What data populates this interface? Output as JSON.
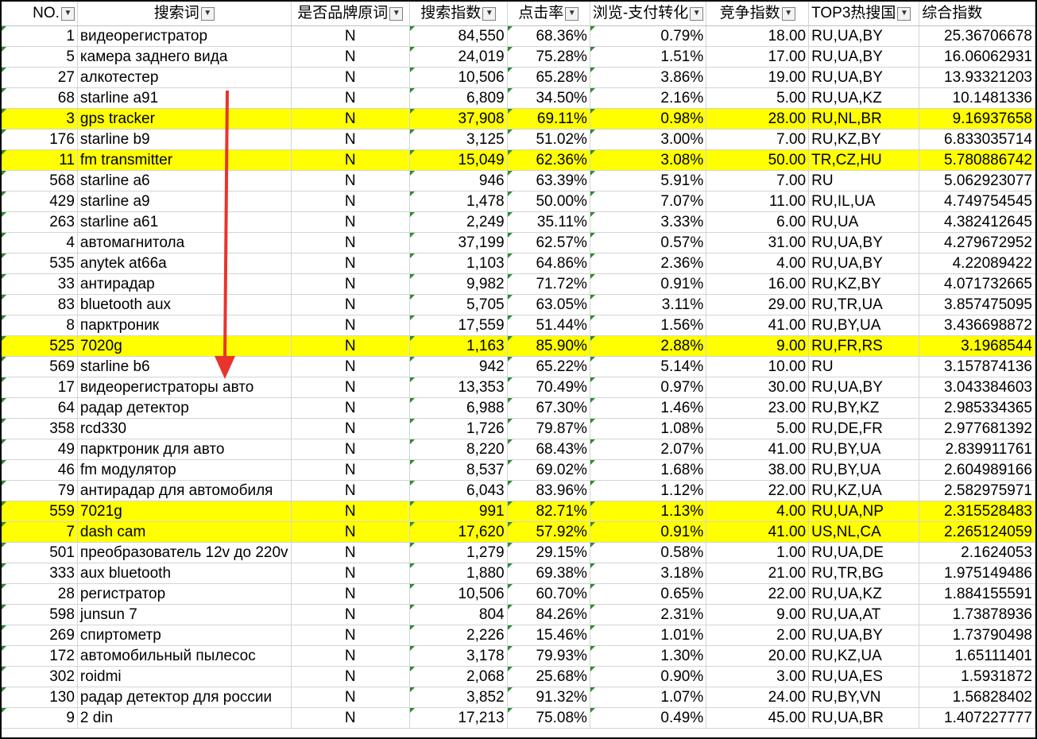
{
  "colors": {
    "highlight": "#ffff00",
    "arrow": "#e8342c",
    "corner_marker": "#2e8b2e"
  },
  "headers": [
    {
      "label": "NO.",
      "filter_icon": "dropdown-arrow-icon"
    },
    {
      "label": "搜索词",
      "filter_icon": "dropdown-arrow-icon"
    },
    {
      "label": "是否品牌原词",
      "filter_icon": "dropdown-arrow-icon"
    },
    {
      "label": "搜索指数",
      "filter_icon": "dropdown-arrow-icon"
    },
    {
      "label": "点击率",
      "filter_icon": "dropdown-arrow-icon"
    },
    {
      "label": "浏览-支付转化",
      "filter_icon": "dropdown-arrow-icon"
    },
    {
      "label": "竞争指数",
      "filter_icon": "dropdown-arrow-icon"
    },
    {
      "label": "TOP3热搜国",
      "filter_icon": "dropdown-arrow-icon"
    },
    {
      "label": "综合指数",
      "filter_icon": ""
    }
  ],
  "rows": [
    {
      "no": "1",
      "term": "видеорегистратор",
      "brand": "N",
      "search": "84,550",
      "ctr": "68.36%",
      "conv": "0.79%",
      "comp": "18.00",
      "top3": "RU,UA,BY",
      "score": "25.36706678",
      "highlight": false
    },
    {
      "no": "5",
      "term": "камера заднего вида",
      "brand": "N",
      "search": "24,019",
      "ctr": "75.28%",
      "conv": "1.51%",
      "comp": "17.00",
      "top3": "RU,UA,BY",
      "score": "16.06062931",
      "highlight": false
    },
    {
      "no": "27",
      "term": "алкотестер",
      "brand": "N",
      "search": "10,506",
      "ctr": "65.28%",
      "conv": "3.86%",
      "comp": "19.00",
      "top3": "RU,UA,BY",
      "score": "13.93321203",
      "highlight": false
    },
    {
      "no": "68",
      "term": "starline a91",
      "brand": "N",
      "search": "6,809",
      "ctr": "34.50%",
      "conv": "2.16%",
      "comp": "5.00",
      "top3": "RU,UA,KZ",
      "score": "10.1481336",
      "highlight": false
    },
    {
      "no": "3",
      "term": "gps tracker",
      "brand": "N",
      "search": "37,908",
      "ctr": "69.11%",
      "conv": "0.98%",
      "comp": "28.00",
      "top3": "RU,NL,BR",
      "score": "9.16937658",
      "highlight": true
    },
    {
      "no": "176",
      "term": "starline b9",
      "brand": "N",
      "search": "3,125",
      "ctr": "51.02%",
      "conv": "3.00%",
      "comp": "7.00",
      "top3": "RU,KZ,BY",
      "score": "6.833035714",
      "highlight": false
    },
    {
      "no": "11",
      "term": "fm transmitter",
      "brand": "N",
      "search": "15,049",
      "ctr": "62.36%",
      "conv": "3.08%",
      "comp": "50.00",
      "top3": "TR,CZ,HU",
      "score": "5.780886742",
      "highlight": true
    },
    {
      "no": "568",
      "term": "starline a6",
      "brand": "N",
      "search": "946",
      "ctr": "63.39%",
      "conv": "5.91%",
      "comp": "7.00",
      "top3": "RU",
      "score": "5.062923077",
      "highlight": false
    },
    {
      "no": "429",
      "term": "starline a9",
      "brand": "N",
      "search": "1,478",
      "ctr": "50.00%",
      "conv": "7.07%",
      "comp": "11.00",
      "top3": "RU,IL,UA",
      "score": "4.749754545",
      "highlight": false
    },
    {
      "no": "263",
      "term": "starline a61",
      "brand": "N",
      "search": "2,249",
      "ctr": "35.11%",
      "conv": "3.33%",
      "comp": "6.00",
      "top3": "RU,UA",
      "score": "4.382412645",
      "highlight": false
    },
    {
      "no": "4",
      "term": "автомагнитола",
      "brand": "N",
      "search": "37,199",
      "ctr": "62.57%",
      "conv": "0.57%",
      "comp": "31.00",
      "top3": "RU,UA,BY",
      "score": "4.279672952",
      "highlight": false
    },
    {
      "no": "535",
      "term": "anytek at66a",
      "brand": "N",
      "search": "1,103",
      "ctr": "64.86%",
      "conv": "2.36%",
      "comp": "4.00",
      "top3": "RU,UA,BY",
      "score": "4.22089422",
      "highlight": false
    },
    {
      "no": "33",
      "term": "антирадар",
      "brand": "N",
      "search": "9,982",
      "ctr": "71.72%",
      "conv": "0.91%",
      "comp": "16.00",
      "top3": "RU,KZ,BY",
      "score": "4.071732665",
      "highlight": false
    },
    {
      "no": "83",
      "term": "bluetooth aux",
      "brand": "N",
      "search": "5,705",
      "ctr": "63.05%",
      "conv": "3.11%",
      "comp": "29.00",
      "top3": "RU,TR,UA",
      "score": "3.857475095",
      "highlight": false
    },
    {
      "no": "8",
      "term": "парктроник",
      "brand": "N",
      "search": "17,559",
      "ctr": "51.44%",
      "conv": "1.56%",
      "comp": "41.00",
      "top3": "RU,BY,UA",
      "score": "3.436698872",
      "highlight": false
    },
    {
      "no": "525",
      "term": "7020g",
      "brand": "N",
      "search": "1,163",
      "ctr": "85.90%",
      "conv": "2.88%",
      "comp": "9.00",
      "top3": "RU,FR,RS",
      "score": "3.1968544",
      "highlight": true
    },
    {
      "no": "569",
      "term": "starline b6",
      "brand": "N",
      "search": "942",
      "ctr": "65.22%",
      "conv": "5.14%",
      "comp": "10.00",
      "top3": "RU",
      "score": "3.157874136",
      "highlight": false
    },
    {
      "no": "17",
      "term": "видеорегистраторы авто",
      "brand": "N",
      "search": "13,353",
      "ctr": "70.49%",
      "conv": "0.97%",
      "comp": "30.00",
      "top3": "RU,UA,BY",
      "score": "3.043384603",
      "highlight": false
    },
    {
      "no": "64",
      "term": "радар детектор",
      "brand": "N",
      "search": "6,988",
      "ctr": "67.30%",
      "conv": "1.46%",
      "comp": "23.00",
      "top3": "RU,BY,KZ",
      "score": "2.985334365",
      "highlight": false
    },
    {
      "no": "358",
      "term": "rcd330",
      "brand": "N",
      "search": "1,726",
      "ctr": "79.87%",
      "conv": "1.08%",
      "comp": "5.00",
      "top3": "RU,DE,FR",
      "score": "2.977681392",
      "highlight": false
    },
    {
      "no": "49",
      "term": "парктроник для авто",
      "brand": "N",
      "search": "8,220",
      "ctr": "68.43%",
      "conv": "2.07%",
      "comp": "41.00",
      "top3": "RU,BY,UA",
      "score": "2.839911761",
      "highlight": false
    },
    {
      "no": "46",
      "term": "fm модулятор",
      "brand": "N",
      "search": "8,537",
      "ctr": "69.02%",
      "conv": "1.68%",
      "comp": "38.00",
      "top3": "RU,BY,UA",
      "score": "2.604989166",
      "highlight": false
    },
    {
      "no": "79",
      "term": "антирадар для автомобиля",
      "brand": "N",
      "search": "6,043",
      "ctr": "83.96%",
      "conv": "1.12%",
      "comp": "22.00",
      "top3": "RU,KZ,UA",
      "score": "2.582975971",
      "highlight": false
    },
    {
      "no": "559",
      "term": "7021g",
      "brand": "N",
      "search": "991",
      "ctr": "82.71%",
      "conv": "1.13%",
      "comp": "4.00",
      "top3": "RU,UA,NP",
      "score": "2.315528483",
      "highlight": true
    },
    {
      "no": "7",
      "term": "dash cam",
      "brand": "N",
      "search": "17,620",
      "ctr": "57.92%",
      "conv": "0.91%",
      "comp": "41.00",
      "top3": "US,NL,CA",
      "score": "2.265124059",
      "highlight": true
    },
    {
      "no": "501",
      "term": "преобразователь 12v до 220v",
      "brand": "N",
      "search": "1,279",
      "ctr": "29.15%",
      "conv": "0.58%",
      "comp": "1.00",
      "top3": "RU,UA,DE",
      "score": "2.1624053",
      "highlight": false
    },
    {
      "no": "333",
      "term": "aux bluetooth",
      "brand": "N",
      "search": "1,880",
      "ctr": "69.38%",
      "conv": "3.18%",
      "comp": "21.00",
      "top3": "RU,TR,BG",
      "score": "1.975149486",
      "highlight": false
    },
    {
      "no": "28",
      "term": "регистратор",
      "brand": "N",
      "search": "10,506",
      "ctr": "60.70%",
      "conv": "0.65%",
      "comp": "22.00",
      "top3": "RU,UA,KZ",
      "score": "1.884155591",
      "highlight": false
    },
    {
      "no": "598",
      "term": "junsun 7",
      "brand": "N",
      "search": "804",
      "ctr": "84.26%",
      "conv": "2.31%",
      "comp": "9.00",
      "top3": "RU,UA,AT",
      "score": "1.73878936",
      "highlight": false
    },
    {
      "no": "269",
      "term": "спиртометр",
      "brand": "N",
      "search": "2,226",
      "ctr": "15.46%",
      "conv": "1.01%",
      "comp": "2.00",
      "top3": "RU,UA,BY",
      "score": "1.73790498",
      "highlight": false
    },
    {
      "no": "172",
      "term": "автомобильный пылесос",
      "brand": "N",
      "search": "3,178",
      "ctr": "79.93%",
      "conv": "1.30%",
      "comp": "20.00",
      "top3": "RU,KZ,UA",
      "score": "1.65111401",
      "highlight": false
    },
    {
      "no": "302",
      "term": "roidmi",
      "brand": "N",
      "search": "2,068",
      "ctr": "25.68%",
      "conv": "0.90%",
      "comp": "3.00",
      "top3": "RU,UA,ES",
      "score": "1.5931872",
      "highlight": false
    },
    {
      "no": "130",
      "term": "радар детектор для россии",
      "brand": "N",
      "search": "3,852",
      "ctr": "91.32%",
      "conv": "1.07%",
      "comp": "24.00",
      "top3": "RU,BY,VN",
      "score": "1.56828402",
      "highlight": false
    },
    {
      "no": "9",
      "term": "2 din",
      "brand": "N",
      "search": "17,213",
      "ctr": "75.08%",
      "conv": "0.49%",
      "comp": "45.00",
      "top3": "RU,UA,BR",
      "score": "1.407227777",
      "highlight": false
    }
  ]
}
